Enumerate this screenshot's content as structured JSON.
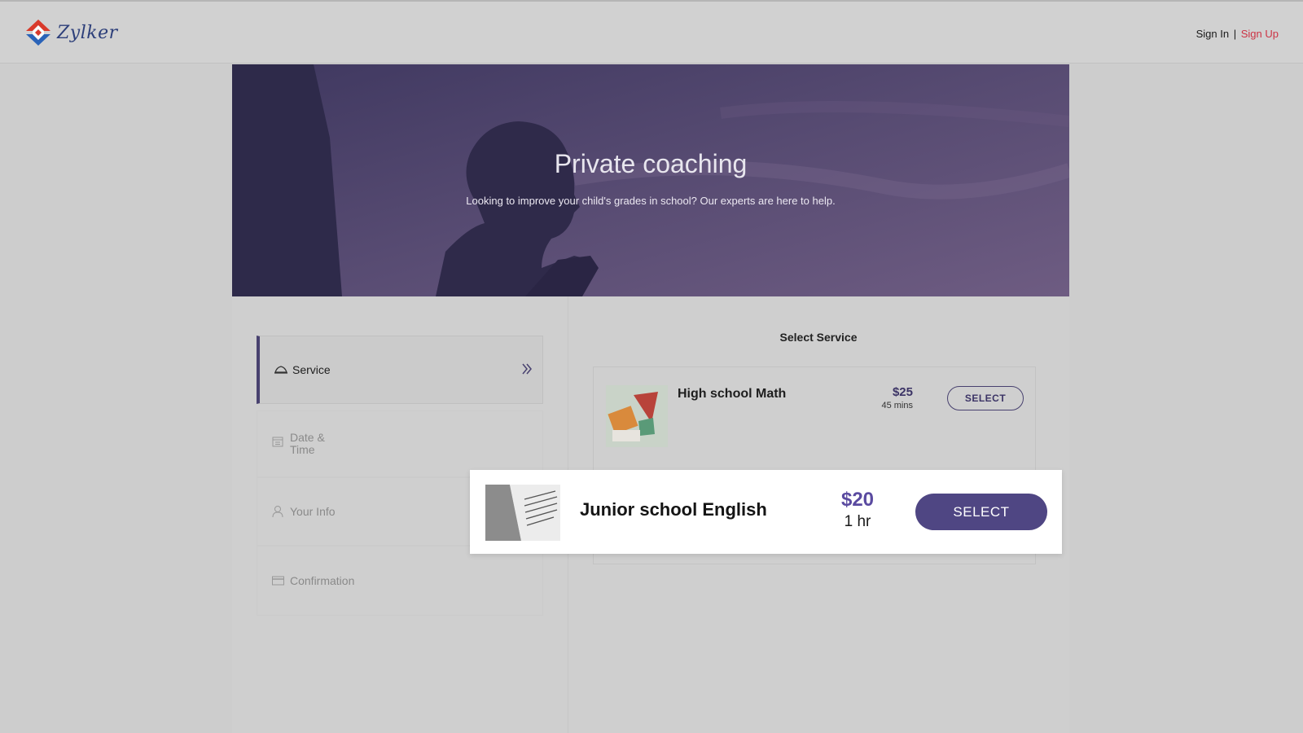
{
  "header": {
    "logo_text": "Zylker",
    "sign_in": "Sign In",
    "separator": "|",
    "sign_up": "Sign Up"
  },
  "hero": {
    "title": "Private coaching",
    "subtitle": "Looking to improve your child's grades in school? Our experts are here to help."
  },
  "steps": [
    {
      "label": "Service",
      "icon": "service-icon",
      "active": true
    },
    {
      "label": "Date & Time",
      "icon": "calendar-icon",
      "active": false
    },
    {
      "label": "Your Info",
      "icon": "user-icon",
      "active": false
    },
    {
      "label": "Confirmation",
      "icon": "card-icon",
      "active": false
    }
  ],
  "select_title": "Select Service",
  "services": [
    {
      "name": "High school Math",
      "price": "$25",
      "duration": "45 mins",
      "button": "SELECT"
    },
    {
      "name": "Junior school English",
      "price": "$20",
      "duration": "1 hr",
      "button": "SELECT"
    }
  ],
  "colors": {
    "accent": "#48416f",
    "button_fill": "#4f4683",
    "price_highlight": "#5a4aa0",
    "sign_up": "#cc3344"
  }
}
